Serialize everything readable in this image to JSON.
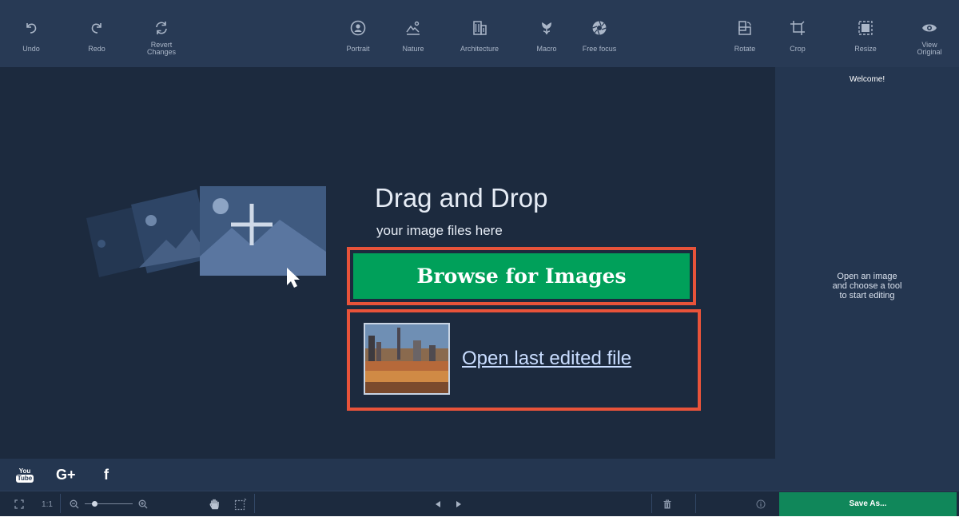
{
  "toolbar": {
    "undo": "Undo",
    "redo": "Redo",
    "revert_line1": "Revert",
    "revert_line2": "Changes",
    "portrait": "Portrait",
    "nature": "Nature",
    "architecture": "Architecture",
    "macro": "Macro",
    "free_focus": "Free focus",
    "rotate": "Rotate",
    "crop": "Crop",
    "resize": "Resize",
    "view_line1": "View",
    "view_line2": "Original"
  },
  "main": {
    "drag_title": "Drag and Drop",
    "drag_subtitle": "your image files here",
    "browse_label": "Browse for Images",
    "open_last_label": "Open last edited file"
  },
  "panel": {
    "welcome": "Welcome!",
    "hint": "Open an image\nand choose a tool\nto start editing"
  },
  "social": {
    "youtube_top": "You",
    "youtube_bottom": "Tube",
    "gplus": "G+",
    "facebook": "f"
  },
  "statusbar": {
    "actual_size": "1:1",
    "zoom_level": 0.2,
    "save_as": "Save As..."
  },
  "colors": {
    "accent_green": "#00a05a",
    "highlight_outline": "#e8533a",
    "background": "#1c2a3e",
    "toolbar": "#283a55"
  }
}
